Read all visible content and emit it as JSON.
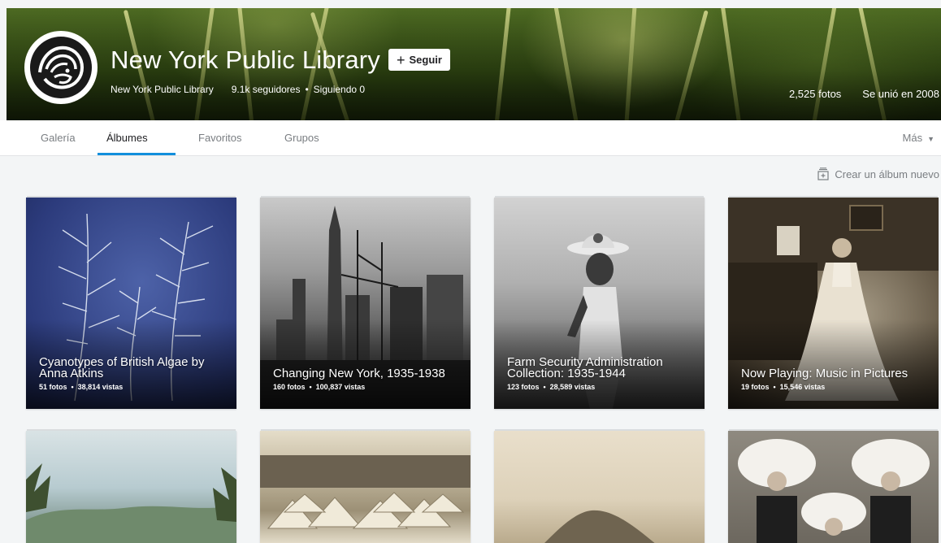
{
  "profile": {
    "name": "New York Public Library",
    "follow_label": "Seguir",
    "subname": "New York Public Library",
    "followers": "9.1k seguidores",
    "following": "Siguiendo 0",
    "photos": "2,525 fotos",
    "joined": "Se unió en 2008"
  },
  "tabs": [
    {
      "label": "Galería"
    },
    {
      "label": "Álbumes"
    },
    {
      "label": "Favoritos"
    },
    {
      "label": "Grupos"
    }
  ],
  "more_label": "Más",
  "create_album_label": "Crear un álbum nuevo",
  "albums": [
    {
      "title": "Cyanotypes of British Algae by Anna Atkins",
      "photos": "51 fotos",
      "views": "38,814 vistas"
    },
    {
      "title": "Changing New York, 1935-1938",
      "photos": "160 fotos",
      "views": "100,837 vistas"
    },
    {
      "title": "Farm Security Administration Collection: 1935-1944",
      "photos": "123 fotos",
      "views": "28,589 vistas"
    },
    {
      "title": "Now Playing: Music in Pictures",
      "photos": "19 fotos",
      "views": "15,546 vistas"
    }
  ],
  "colors": {
    "accent": "#128fdc",
    "text_dark": "#212124",
    "text_muted": "#7a7e82",
    "page_bg": "#f3f5f6"
  }
}
